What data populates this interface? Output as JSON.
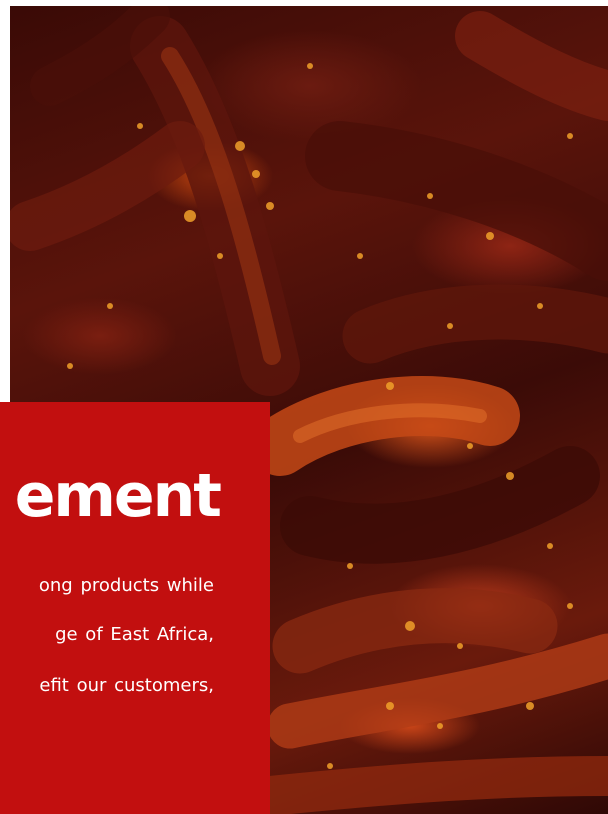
{
  "hero": {
    "image_description": "dried red chili peppers"
  },
  "panel": {
    "heading": "ement",
    "lines": [
      "ong products while",
      "ge  of  East  Africa,",
      "efit our customers,"
    ]
  },
  "colors": {
    "panel_background": "#c20f0f",
    "text": "#ffffff"
  }
}
